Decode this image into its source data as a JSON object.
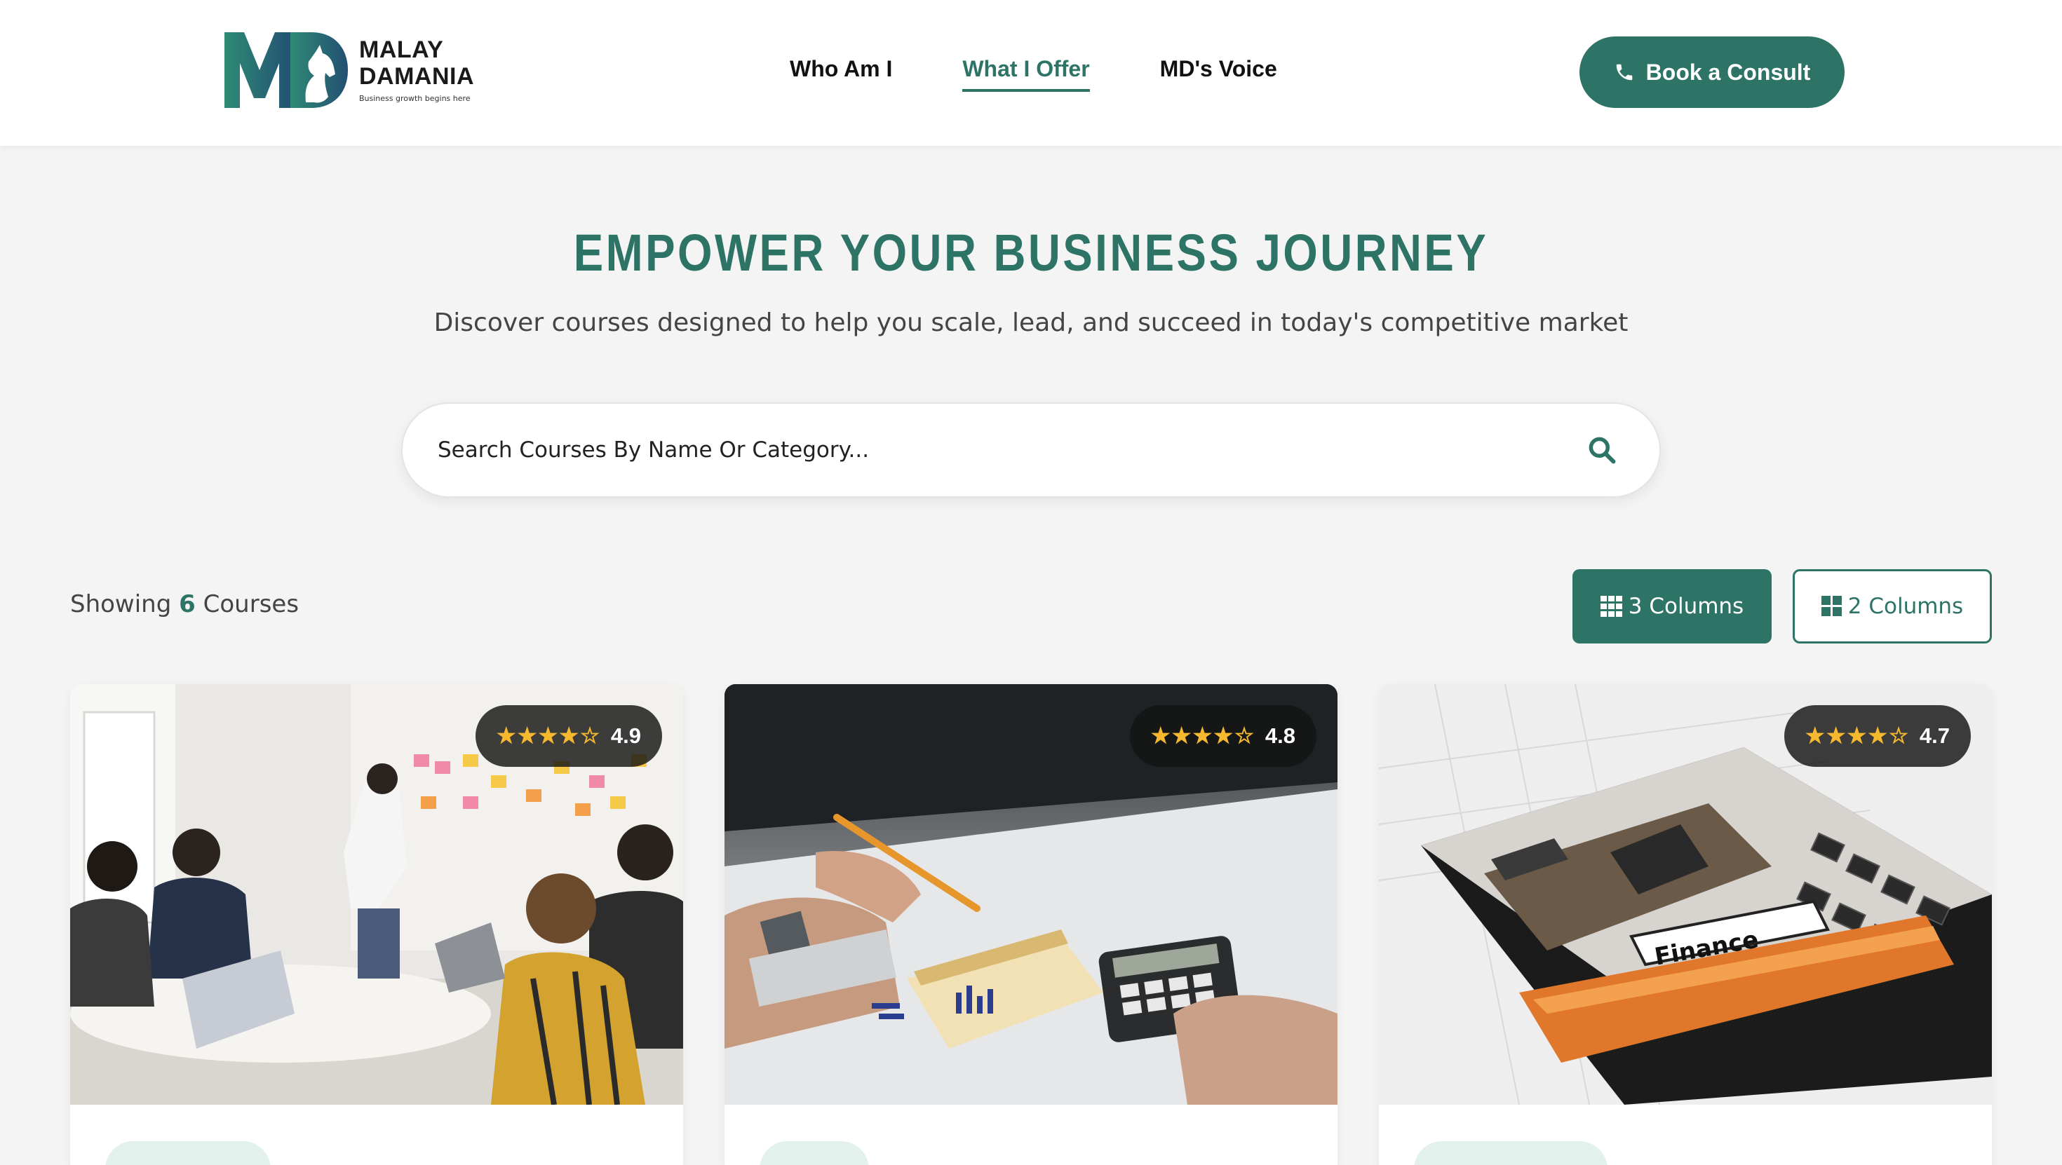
{
  "header": {
    "logo": {
      "name_line1": "MALAY",
      "name_line2": "DAMANIA",
      "tagline": "Business growth begins here"
    },
    "nav": [
      {
        "label": "Who Am I",
        "active": false
      },
      {
        "label": "What I Offer",
        "active": true
      },
      {
        "label": "MD's Voice",
        "active": false
      }
    ],
    "cta": {
      "label": "Book a Consult",
      "icon": "phone-icon"
    }
  },
  "hero": {
    "title": "EMPOWER YOUR BUSINESS JOURNEY",
    "subtitle": "Discover courses designed to help you scale, lead, and succeed in today's competitive market"
  },
  "search": {
    "placeholder": "Search Courses By Name Or Category...",
    "icon": "search-icon"
  },
  "results": {
    "prefix": "Showing",
    "count": "6",
    "suffix": "Courses"
  },
  "layout_toggle": {
    "three": {
      "label": "3 Columns",
      "icon": "grid-3-icon",
      "selected": true
    },
    "two": {
      "label": "2 Columns",
      "icon": "grid-2-icon",
      "selected": false
    }
  },
  "courses": [
    {
      "rating": "4.9",
      "stars": "★★★★☆",
      "image": "team-meeting-photo"
    },
    {
      "rating": "4.8",
      "stars": "★★★★☆",
      "image": "calculator-notebook-photo"
    },
    {
      "rating": "4.7",
      "stars": "★★★★☆",
      "image": "finance-keyboard-photo"
    }
  ],
  "colors": {
    "brand": "#2e7466",
    "background": "#f4f4f4",
    "star": "#f5b82e"
  }
}
